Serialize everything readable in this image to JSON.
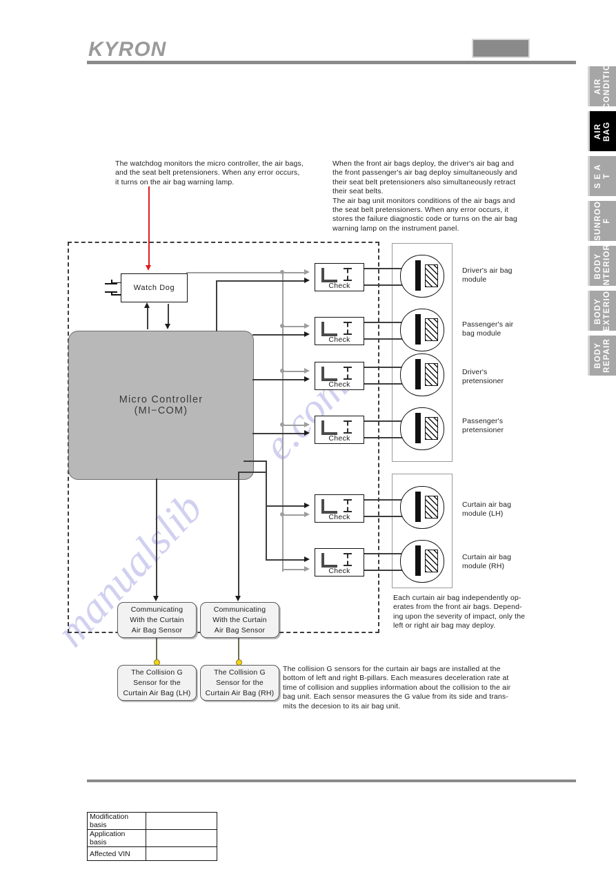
{
  "header": {
    "logo": "KYRON",
    "badge_label": ""
  },
  "tabs": [
    {
      "label": "AIR\nCONDITIO",
      "active": false,
      "name": "tab-air-conditioner"
    },
    {
      "label": "AIR BAG",
      "active": true,
      "name": "tab-air-bag"
    },
    {
      "label": "S E A T",
      "active": false,
      "name": "tab-seat"
    },
    {
      "label": "SUNROO\nF",
      "active": false,
      "name": "tab-sunroof"
    },
    {
      "label": "BODY\nINTERIOR",
      "active": false,
      "name": "tab-body-interior"
    },
    {
      "label": "BODY\nEXTERIO",
      "active": false,
      "name": "tab-body-exterior"
    },
    {
      "label": "BODY\nREPAIR",
      "active": false,
      "name": "tab-body-repair"
    }
  ],
  "notes": {
    "watchdog": "The watchdog monitors the micro controller, the air bags,\nand the seat belt pretensioners. When any error occurs,\nit turns on the air bag warning lamp.",
    "deployment": "When the front air bags deploy,  the driver's air bag and\nthe front passenger's air bag deploy simultaneously and\ntheir seat belt pretensioners also simultaneously retract\ntheir seat belts.\nThe air bag unit monitors conditions of the air bags and\nthe seat belt pretensioners. When any error occurs, it\nstores the failure diagnostic code or turns on the air bag\nwarning lamp on the instrument panel.",
    "curtain": "Each curtain air bag independently op-\nerates from the front air bags. Depend-\ning upon the severity of impact, only the\nleft or right air bag may deploy.",
    "gsensor": "The collision G sensors for the curtain air bags are installed at the\nbottom of left and right B-pillars. Each measures deceleration rate at\ntime of collision and supplies information about the collision to the air\nbag unit. Each sensor measures the G value from its side and trans-\nmits the decesion to its air bag unit."
  },
  "diagram": {
    "watchdog_label": "Watch Dog",
    "mcu_line1": "Micro  Controller",
    "mcu_line2": "(MI−COM)",
    "check_label": "Check",
    "checks": [
      {
        "label": "Check"
      },
      {
        "label": "Check"
      },
      {
        "label": "Check"
      },
      {
        "label": "Check"
      },
      {
        "label": "Check"
      },
      {
        "label": "Check"
      }
    ],
    "modules": [
      {
        "label": "Driver's air bag\nmodule"
      },
      {
        "label": "Passenger's air\nbag module"
      },
      {
        "label": "Driver's\npretensioner"
      },
      {
        "label": "Passenger's\npretensioner"
      },
      {
        "label": "Curtain air bag\nmodule (LH)"
      },
      {
        "label": "Curtain air bag\nmodule (RH)"
      }
    ],
    "comm_boxes": [
      {
        "label": "Communicating\nWith the Curtain\nAir Bag Sensor"
      },
      {
        "label": "Communicating\nWith the Curtain\nAir Bag Sensor"
      }
    ],
    "sensor_boxes": [
      {
        "label": "The Collision G\nSensor for the\nCurtain Air Bag (LH)"
      },
      {
        "label": "The Collision G\nSensor for the\nCurtain Air Bag (RH)"
      }
    ]
  },
  "footer_table": {
    "rows": [
      {
        "key": "Modification basis",
        "value": ""
      },
      {
        "key": "Application basis",
        "value": ""
      },
      {
        "key": "Affected VIN",
        "value": ""
      }
    ]
  },
  "watermark": {
    "text1": "manualslib",
    "text2": "e.com"
  },
  "colors": {
    "accent_gray": "#8a8a8a",
    "mcu_fill": "#b8b8b8",
    "active_tab": "#000000",
    "arrow_red": "#e01b1b",
    "junction_yellow": "#f2d31a"
  }
}
